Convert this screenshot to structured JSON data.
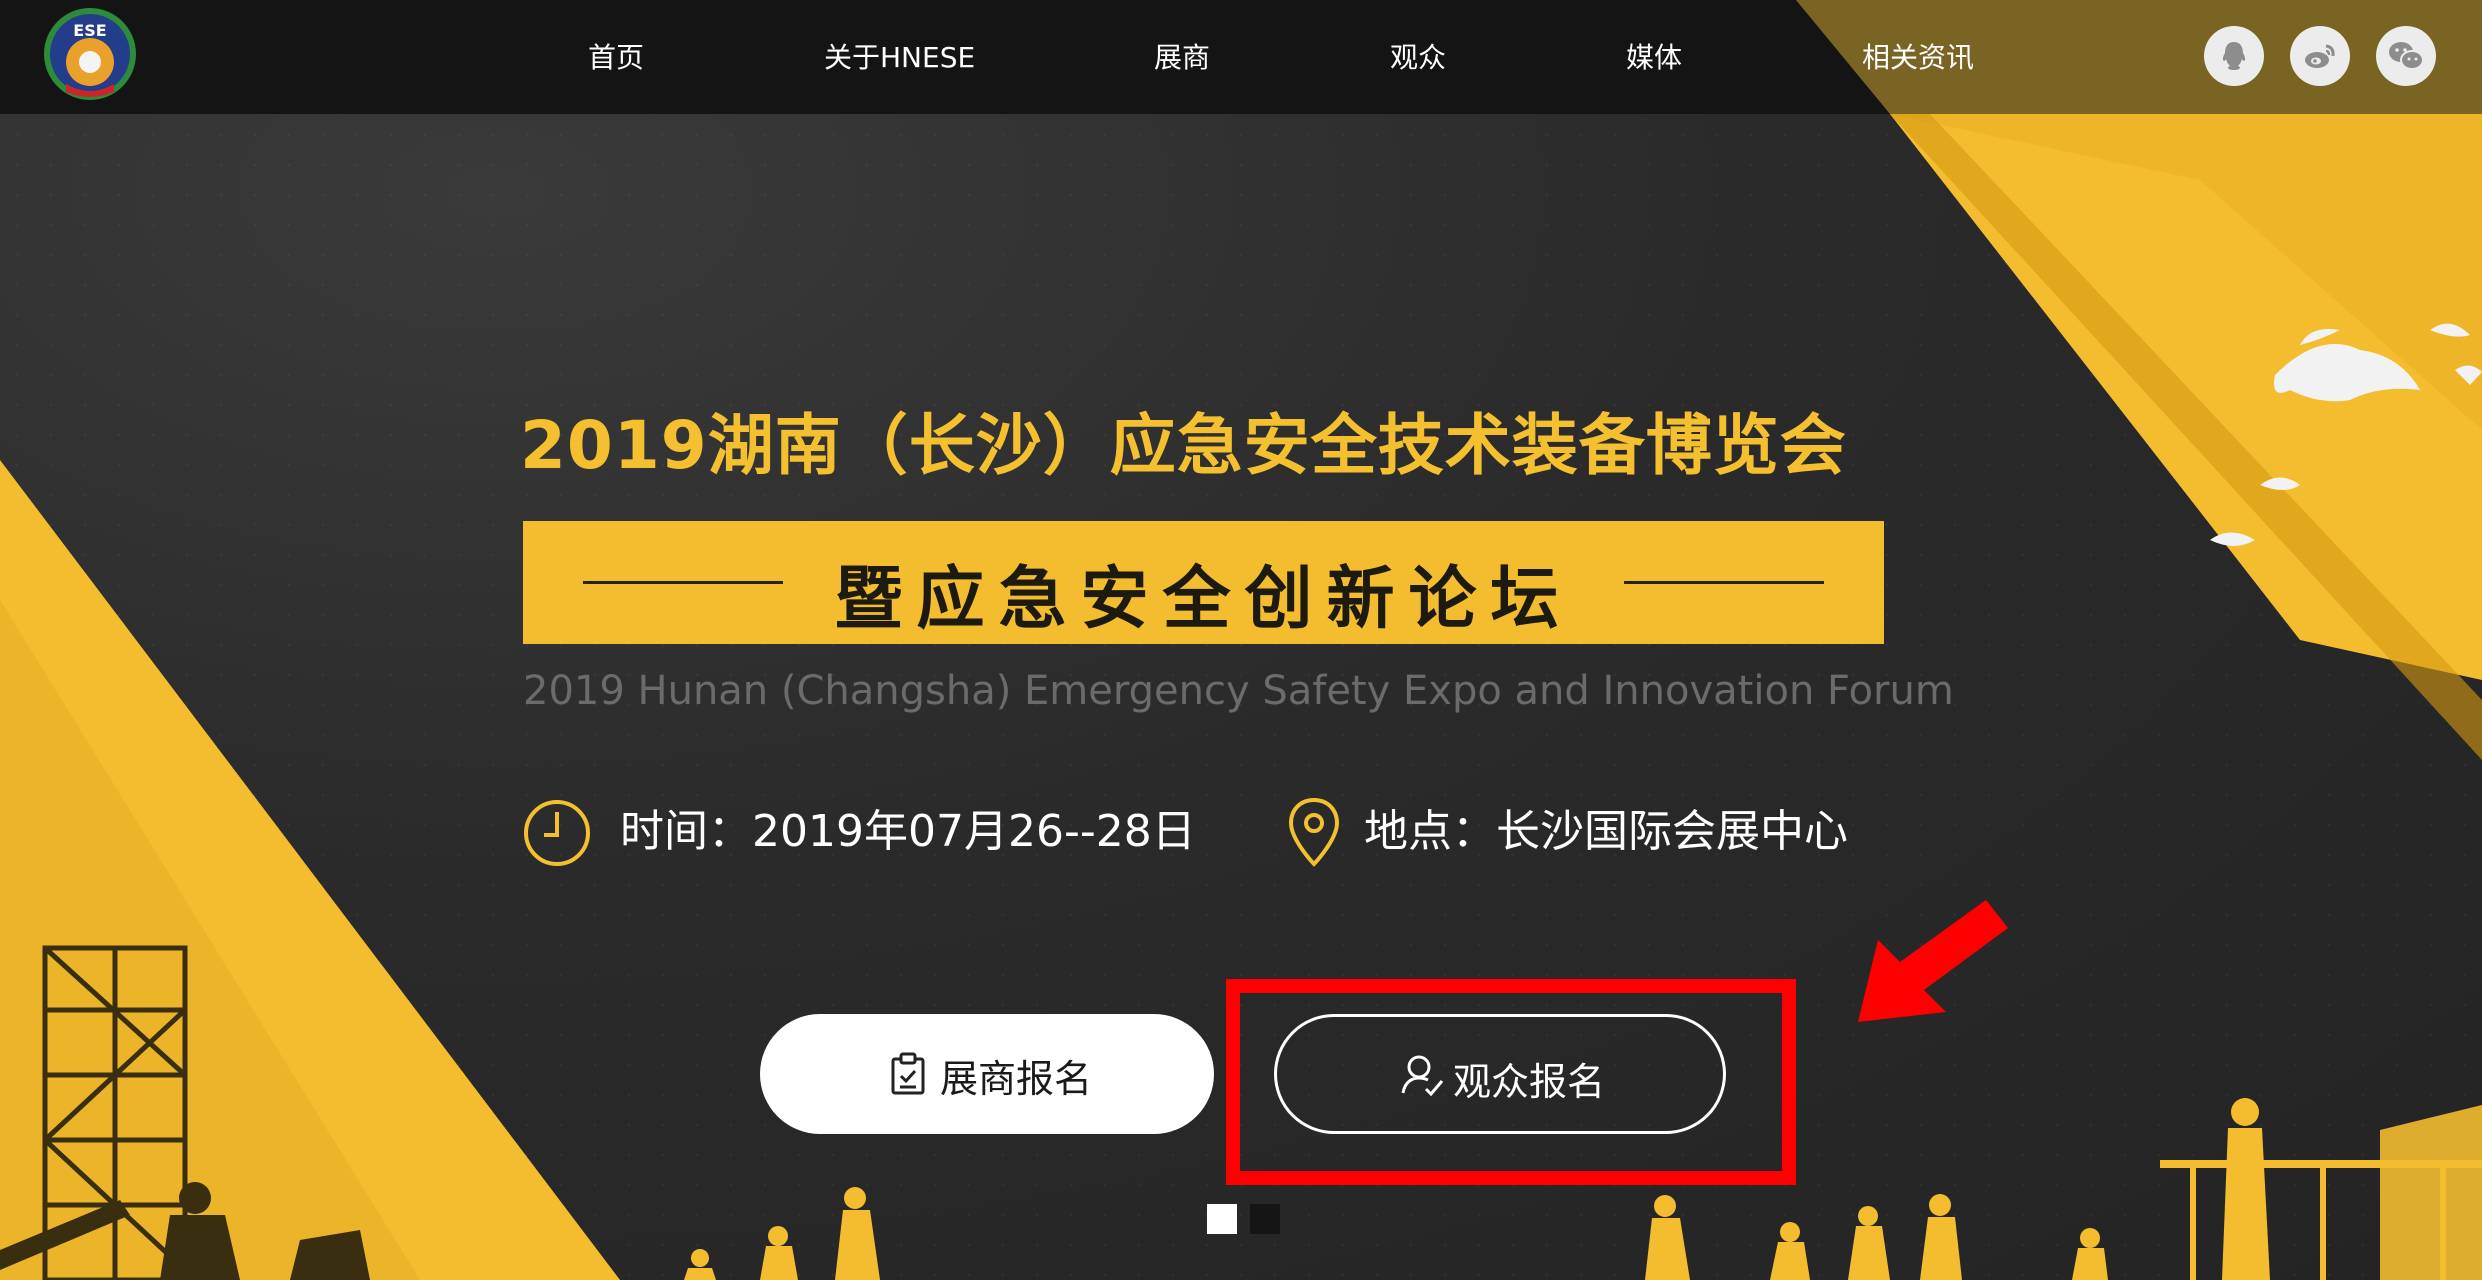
{
  "nav": {
    "logo_text": "ESE",
    "items": [
      {
        "label": "首页"
      },
      {
        "label": "关于HNESE"
      },
      {
        "label": "展商"
      },
      {
        "label": "观众"
      },
      {
        "label": "媒体"
      },
      {
        "label": "相关资讯"
      }
    ],
    "social": [
      {
        "icon": "qq-icon"
      },
      {
        "icon": "weibo-icon"
      },
      {
        "icon": "wechat-icon"
      }
    ]
  },
  "hero": {
    "title": "2019湖南（长沙）应急安全技术装备博览会",
    "banner": "暨应急安全创新论坛",
    "subtitle": "2019 Hunan (Changsha) Emergency Safety Expo and Innovation Forum",
    "time_label": "时间：2019年07月26--28日",
    "place_label": "地点：长沙国际会展中心"
  },
  "buttons": {
    "exhibitor": "展商报名",
    "visitor": "观众报名"
  },
  "colors": {
    "accent_gold": "#f4c030",
    "nav_bg": "#141414",
    "highlight_red": "#ff0000"
  }
}
